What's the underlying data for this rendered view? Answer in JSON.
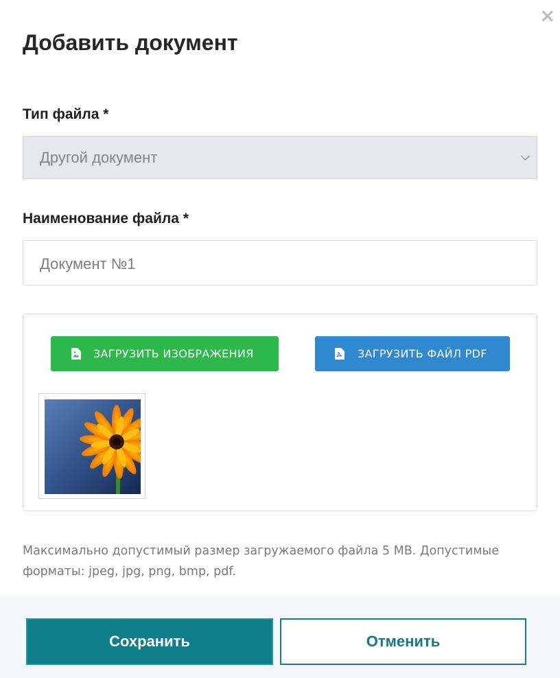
{
  "dialog": {
    "title": "Добавить документ",
    "close_icon": "close-icon"
  },
  "file_type": {
    "label": "Тип файла *",
    "value": "Другой документ"
  },
  "file_name": {
    "label": "Наименование файла *",
    "value": "Документ №1"
  },
  "upload": {
    "images_label": "ЗАГРУЗИТЬ ИЗОБРАЖЕНИЯ",
    "images_icon": "image-file-icon",
    "images_color": "#2db84c",
    "pdf_label": "ЗАГРУЗИТЬ ФАЙЛ PDF",
    "pdf_icon": "pdf-file-icon",
    "pdf_color": "#2f88d0"
  },
  "hint": "Максимально допустимый размер загружаемого файла 5 MB. Допустимые форматы: jpeg, jpg, png, bmp, pdf.",
  "footer": {
    "save_label": "Сохранить",
    "cancel_label": "Отменить",
    "accent_color": "#0e7f88"
  }
}
